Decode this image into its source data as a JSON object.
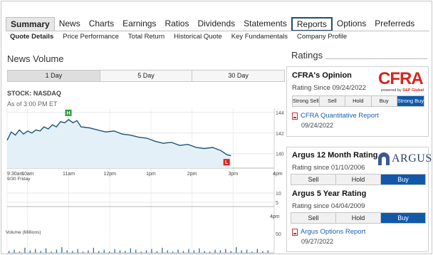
{
  "tabs": [
    {
      "label": "Summary",
      "state": "active"
    },
    {
      "label": "News",
      "state": ""
    },
    {
      "label": "Charts",
      "state": ""
    },
    {
      "label": "Earnings",
      "state": ""
    },
    {
      "label": "Ratios",
      "state": ""
    },
    {
      "label": "Dividends",
      "state": ""
    },
    {
      "label": "Statements",
      "state": ""
    },
    {
      "label": "Reports",
      "state": "highlighted"
    },
    {
      "label": "Options",
      "state": ""
    },
    {
      "label": "Preferreds",
      "state": ""
    }
  ],
  "subtabs": [
    "Quote Details",
    "Price Performance",
    "Total Return",
    "Historical Quote",
    "Key Fundamentals",
    "Company Profile"
  ],
  "news_volume": {
    "title": "News Volume",
    "ranges": [
      "1 Day",
      "5 Day",
      "30 Day"
    ],
    "active_range": "1 Day",
    "stock": "STOCK: NASDAQ",
    "as_of": "As of 3:00 PM ET"
  },
  "chart_data": {
    "type": "area",
    "price_axis": {
      "ticks": [
        144,
        142,
        140
      ],
      "ylim": [
        138.6,
        144.4
      ]
    },
    "x_ticks": [
      "9:30am",
      "10am",
      "11am",
      "12pm",
      "1pm",
      "2pm",
      "3pm",
      "4pm"
    ],
    "x_sub_label": "9/30 Friday",
    "price_series": [
      [
        9.5,
        141.3
      ],
      [
        9.6,
        142.1
      ],
      [
        9.7,
        141.8
      ],
      [
        9.8,
        142.3
      ],
      [
        9.9,
        141.9
      ],
      [
        10.0,
        142.2
      ],
      [
        10.1,
        142.0
      ],
      [
        10.2,
        142.3
      ],
      [
        10.3,
        142.2
      ],
      [
        10.4,
        142.6
      ],
      [
        10.5,
        142.4
      ],
      [
        10.6,
        142.8
      ],
      [
        10.7,
        142.6
      ],
      [
        10.8,
        143.1
      ],
      [
        10.9,
        143.0
      ],
      [
        11.0,
        143.3
      ],
      [
        11.1,
        143.0
      ],
      [
        11.2,
        143.2
      ],
      [
        11.3,
        142.6
      ],
      [
        11.5,
        142.5
      ],
      [
        11.7,
        142.3
      ],
      [
        11.9,
        142.1
      ],
      [
        12.1,
        142.2
      ],
      [
        12.3,
        141.9
      ],
      [
        12.5,
        141.8
      ],
      [
        12.7,
        141.6
      ],
      [
        12.9,
        141.5
      ],
      [
        13.1,
        141.2
      ],
      [
        13.3,
        141.0
      ],
      [
        13.5,
        141.1
      ],
      [
        13.7,
        140.8
      ],
      [
        13.9,
        140.9
      ],
      [
        14.1,
        140.6
      ],
      [
        14.3,
        140.5
      ],
      [
        14.5,
        140.6
      ],
      [
        14.7,
        140.3
      ],
      [
        14.85,
        139.9
      ],
      [
        14.95,
        139.8
      ]
    ],
    "high_marker": {
      "label": "H",
      "x": 11.0,
      "y": 143.3
    },
    "low_marker": {
      "label": "L",
      "x": 14.85,
      "y": 139.9
    },
    "marker_colors": {
      "high": "#2e9e3e",
      "low": "#d9251d"
    },
    "line_color": "#1d5575",
    "fill_color": "#e3f0f8",
    "volume_axis": {
      "ticks": [
        10,
        5
      ]
    },
    "volume_x_tick": "4pm",
    "volume_label": "Volume (Millions)",
    "volume_right_label": "50",
    "grid": true
  },
  "ratings": {
    "title": "Ratings",
    "cfra": {
      "title": "CFRA's Opinion",
      "since": "Rating Since 09/24/2022",
      "logo_text": "CFRA",
      "logo_sub": "S&P Global",
      "logo_power": "powered by",
      "options": [
        "Strong Sell",
        "Sell",
        "Hold",
        "Buy",
        "Strong Buy"
      ],
      "selected": "Strong Buy",
      "report_label": "CFRA Quantitative Report",
      "report_date": "09/24/2022"
    },
    "argus": {
      "logo_text": "ARGUS",
      "m12_title": "Argus 12 Month Rating",
      "m12_since": "Rating since 01/10/2006",
      "m12_options": [
        "Sell",
        "Hold",
        "Buy"
      ],
      "m12_selected": "Buy",
      "y5_title": "Argus 5 Year Rating",
      "y5_since": "Rating since 04/04/2009",
      "y5_options": [
        "Sell",
        "Hold",
        "Buy"
      ],
      "y5_selected": "Buy",
      "report_label": "Argus Options Report",
      "report_date": "09/27/2022"
    }
  }
}
